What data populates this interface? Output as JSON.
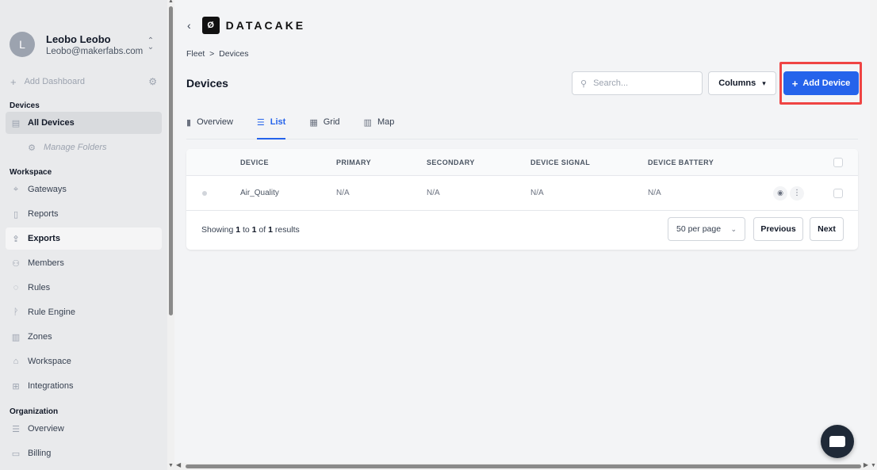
{
  "user": {
    "initial": "L",
    "name": "Leobo Leobo",
    "email": "Leobo@makerfabs.com"
  },
  "sidebar": {
    "add_dashboard": "Add Dashboard",
    "sections": {
      "devices": "Devices",
      "workspace": "Workspace",
      "organization": "Organization"
    },
    "items": {
      "all_devices": "All Devices",
      "manage_folders": "Manage Folders",
      "gateways": "Gateways",
      "reports": "Reports",
      "exports": "Exports",
      "members": "Members",
      "rules": "Rules",
      "rule_engine": "Rule Engine",
      "zones": "Zones",
      "workspace": "Workspace",
      "integrations": "Integrations",
      "overview": "Overview",
      "billing": "Billing"
    }
  },
  "header": {
    "logo_glyph": "Ø",
    "logo_text": "DATACAKE",
    "breadcrumb": "Fleet  >  Devices",
    "page_title": "Devices",
    "search_placeholder": "Search...",
    "columns_label": "Columns",
    "add_device_label": "Add Device"
  },
  "tabs": [
    {
      "label": "Overview",
      "icon": "bar-chart-icon"
    },
    {
      "label": "List",
      "icon": "list-icon"
    },
    {
      "label": "Grid",
      "icon": "grid-icon"
    },
    {
      "label": "Map",
      "icon": "map-icon"
    }
  ],
  "table": {
    "columns": [
      "DEVICE",
      "PRIMARY",
      "SECONDARY",
      "DEVICE SIGNAL",
      "DEVICE BATTERY"
    ],
    "rows": [
      {
        "device": "Air_Quality",
        "primary": "N/A",
        "secondary": "N/A",
        "signal": "N/A",
        "battery": "N/A"
      }
    ],
    "footer": {
      "showing_prefix": "Showing",
      "from": "1",
      "to_word": "to",
      "to": "1",
      "of_word": "of",
      "total": "1",
      "results_word": "results",
      "per_page": "50 per page",
      "previous": "Previous",
      "next": "Next"
    }
  },
  "colors": {
    "accent": "#2563eb",
    "highlight_border": "#ef4444",
    "sidebar_bg": "#e9eaec"
  }
}
